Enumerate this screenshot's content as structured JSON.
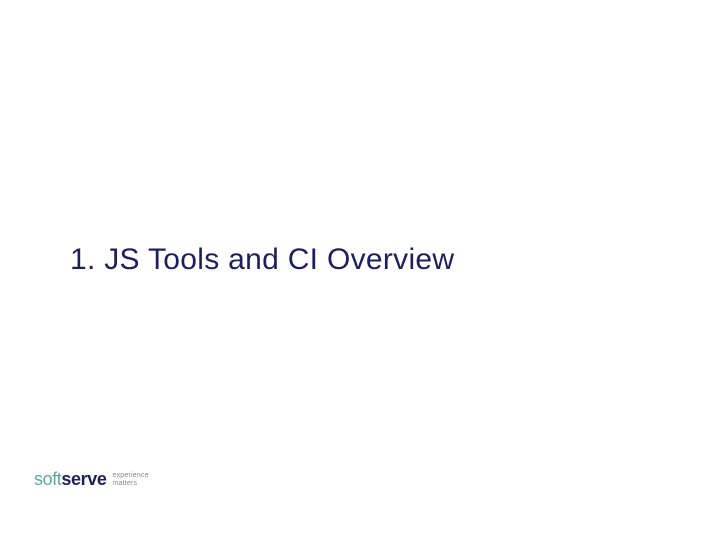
{
  "slide": {
    "title": "1. JS Tools and CI Overview"
  },
  "logo": {
    "part1": "soft",
    "part2": "serve",
    "tagline_line1": "experience",
    "tagline_line2": "matters"
  }
}
